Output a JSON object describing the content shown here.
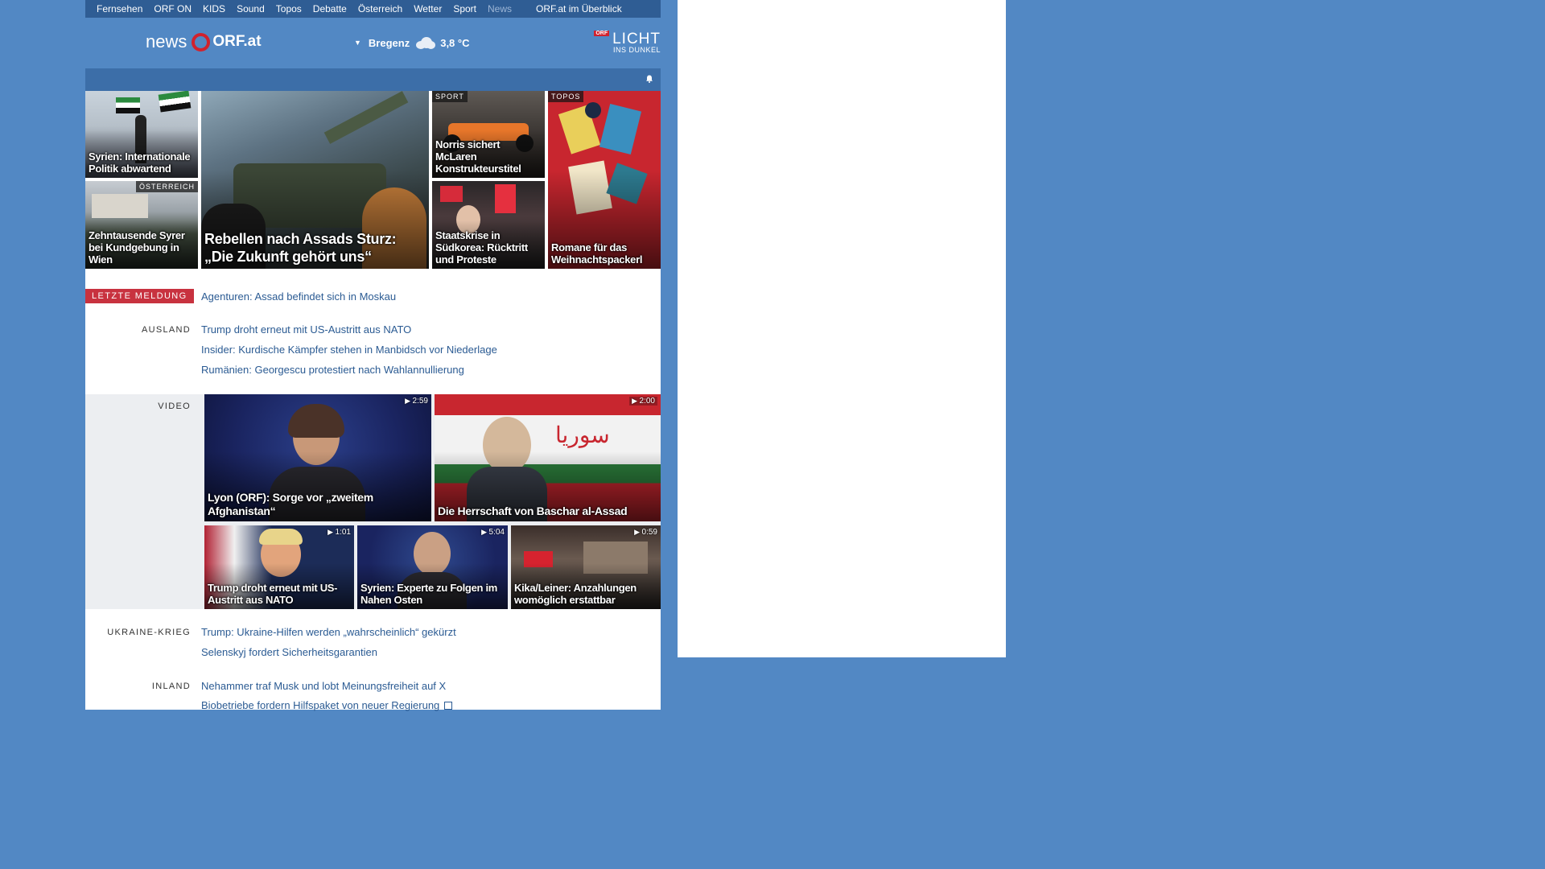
{
  "topnav": [
    "Fernsehen",
    "ORF ON",
    "KIDS",
    "Sound",
    "Topos",
    "Debatte",
    "Österreich",
    "Wetter",
    "Sport",
    "News",
    "ORF.at im Überblick"
  ],
  "header": {
    "logo_news": "news",
    "logo_orf": "ORF.at",
    "weather_city": "Bregenz",
    "weather_temp": "3,8 °C",
    "licht_badge": "ORF",
    "licht_big": "LICHT",
    "licht_small": "INS DUNKEL"
  },
  "tiles": {
    "t1": {
      "caption": "Syrien: Internationale Politik abwartend"
    },
    "t2": {
      "caption": "Zehntausende Syrer bei Kundgebung in Wien",
      "tag": "ÖSTERREICH"
    },
    "main": {
      "caption": "Rebellen nach Assads Sturz: „Die Zukunft gehört uns“"
    },
    "t3": {
      "caption": "Norris sichert McLaren Konstrukteurstitel",
      "tag": "SPORT"
    },
    "t4": {
      "caption": "Staatskrise in Südkorea: Rücktritt und Proteste"
    },
    "t5": {
      "caption": "Romane für das Weihnachtspackerl",
      "tag": "TOPOS"
    }
  },
  "breaking": {
    "label": "LETZTE MELDUNG",
    "text": "Agenturen: Assad befindet sich in Moskau"
  },
  "ausland": {
    "label": "AUSLAND",
    "links": [
      "Trump droht erneut mit US-Austritt aus NATO",
      "Insider: Kurdische Kämpfer stehen in Manbidsch vor Niederlage",
      "Rumänien: Georgescu protestiert nach Wahlannullierung"
    ]
  },
  "video": {
    "label": "VIDEO",
    "items": [
      {
        "caption": "Lyon (ORF): Sorge vor „zweitem Afghanistan“",
        "duration": "2:59"
      },
      {
        "caption": "Die Herrschaft von Baschar al-Assad",
        "duration": "2:00"
      },
      {
        "caption": "Trump droht erneut mit US-Austritt aus NATO",
        "duration": "1:01"
      },
      {
        "caption": "Syrien: Experte zu Folgen im Nahen Osten",
        "duration": "5:04"
      },
      {
        "caption": "Kika/Leiner: Anzahlungen womöglich erstattbar",
        "duration": "0:59"
      }
    ]
  },
  "ukraine": {
    "label": "UKRAINE-KRIEG",
    "links": [
      "Trump: Ukraine-Hilfen werden „wahrscheinlich“ gekürzt",
      "Selenskyj fordert Sicherheitsgarantien"
    ]
  },
  "inland": {
    "label": "INLAND",
    "links": [
      "Nehammer traf Musk und lobt Meinungsfreiheit auf X",
      "Biobetriebe fordern Hilfspaket von neuer Regierung"
    ]
  },
  "colors": {
    "page_bg": "#5288c4",
    "nav_bg": "#2f5d94",
    "accent_red": "#c8323f",
    "link": "#2b5b93"
  }
}
